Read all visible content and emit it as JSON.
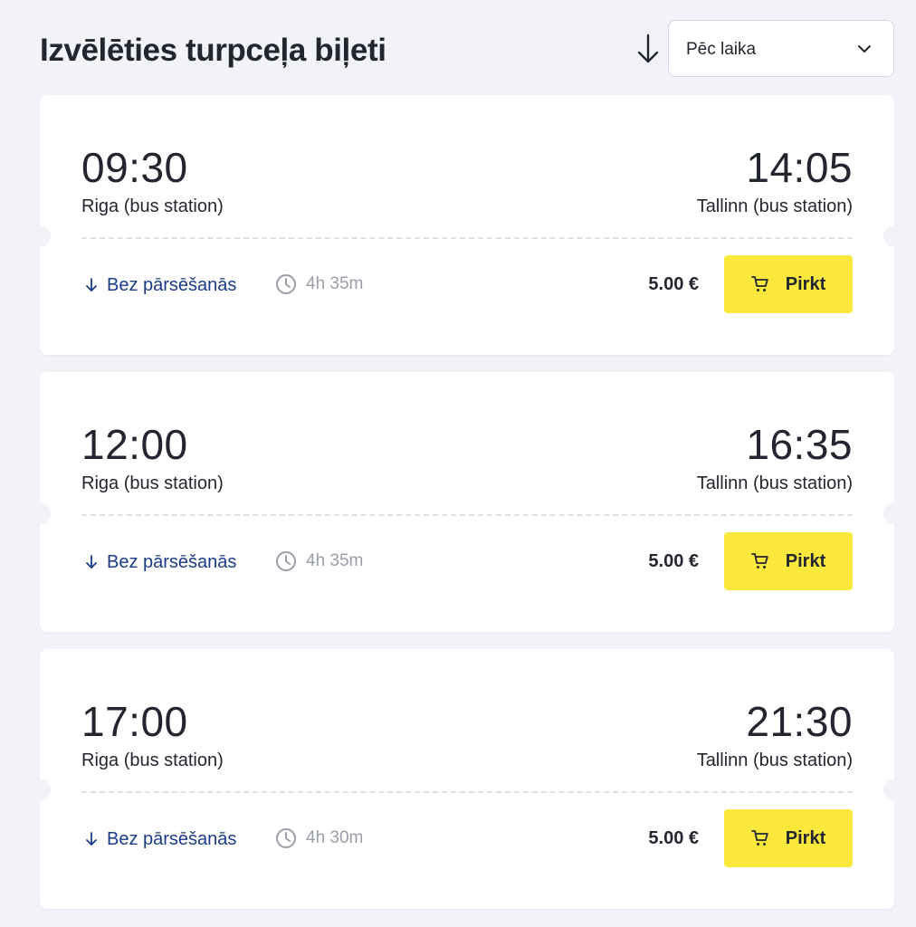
{
  "header": {
    "title": "Izvēlēties turpceļa biļeti",
    "sort_direction_icon": "arrow-down-icon",
    "sort_select": {
      "value": "Pēc laika",
      "icon": "chevron-down-icon"
    }
  },
  "trips": [
    {
      "departure_time": "09:30",
      "departure_station": "Riga (bus station)",
      "arrival_time": "14:05",
      "arrival_station": "Tallinn (bus station)",
      "transfers": "Bez pārsēšanās",
      "duration": "4h 35m",
      "price": "5.00 €",
      "buy_label": "Pirkt"
    },
    {
      "departure_time": "12:00",
      "departure_station": "Riga (bus station)",
      "arrival_time": "16:35",
      "arrival_station": "Tallinn (bus station)",
      "transfers": "Bez pārsēšanās",
      "duration": "4h 35m",
      "price": "5.00 €",
      "buy_label": "Pirkt"
    },
    {
      "departure_time": "17:00",
      "departure_station": "Riga (bus station)",
      "arrival_time": "21:30",
      "arrival_station": "Tallinn (bus station)",
      "transfers": "Bez pārsēšanās",
      "duration": "4h 30m",
      "price": "5.00 €",
      "buy_label": "Pirkt"
    }
  ],
  "colors": {
    "background": "#f1f3f9",
    "card": "#ffffff",
    "accent_button": "#fbe83d",
    "transfer_link": "#1b3b88",
    "muted_text": "#9a9ea8",
    "text": "#23262f"
  }
}
